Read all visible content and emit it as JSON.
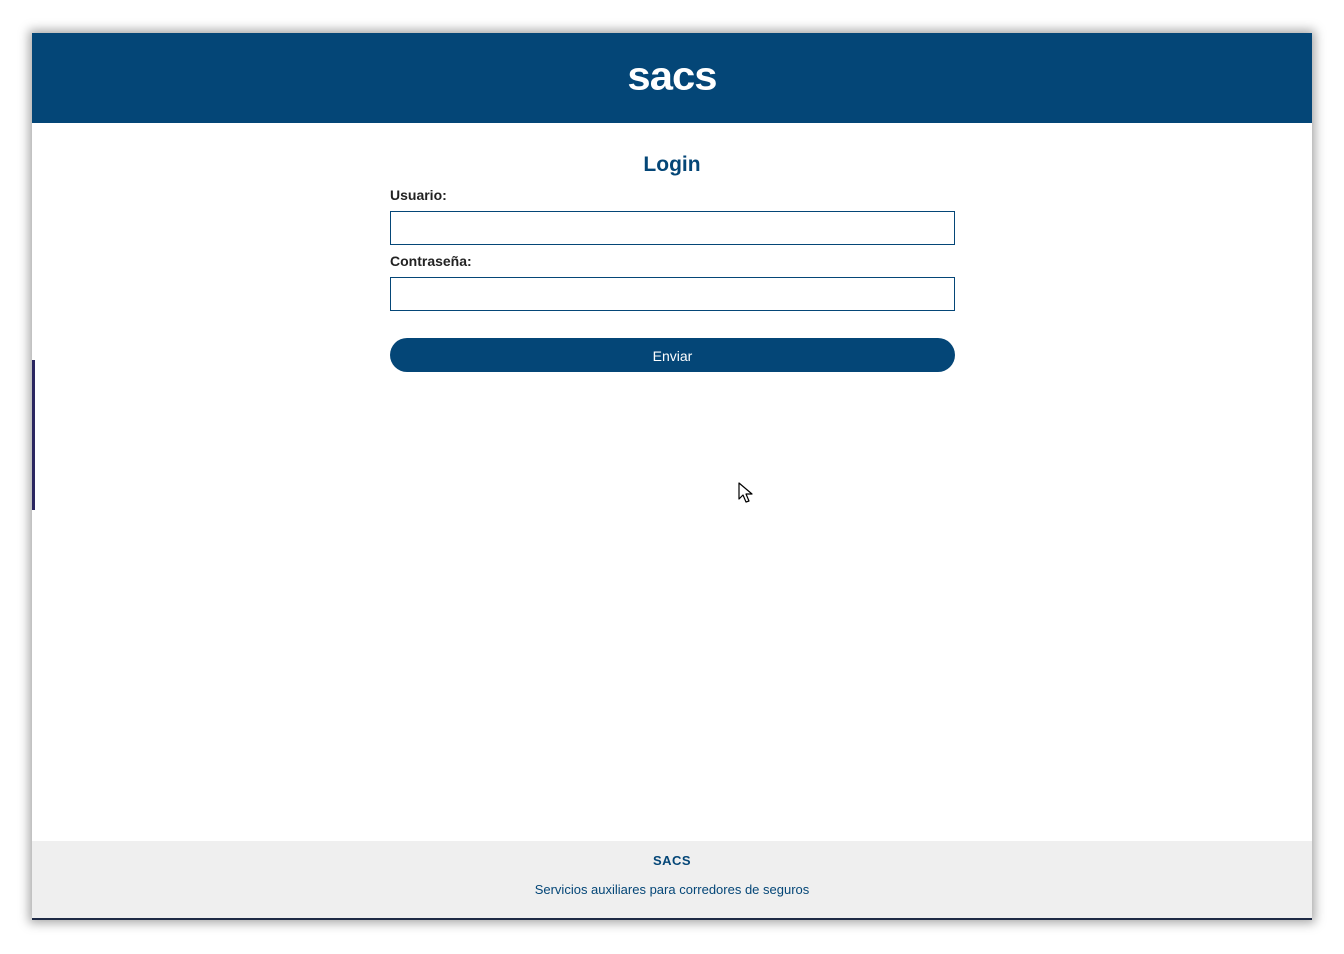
{
  "header": {
    "logo_text": "sacs"
  },
  "login": {
    "title": "Login",
    "username_label": "Usuario:",
    "username_value": "",
    "password_label": "Contraseña:",
    "password_value": "",
    "submit_label": "Enviar"
  },
  "footer": {
    "brand": "SACS",
    "tagline": "Servicios auxiliares para corredores de seguros"
  },
  "colors": {
    "brand_blue": "#044677",
    "footer_bg": "#efefef"
  }
}
